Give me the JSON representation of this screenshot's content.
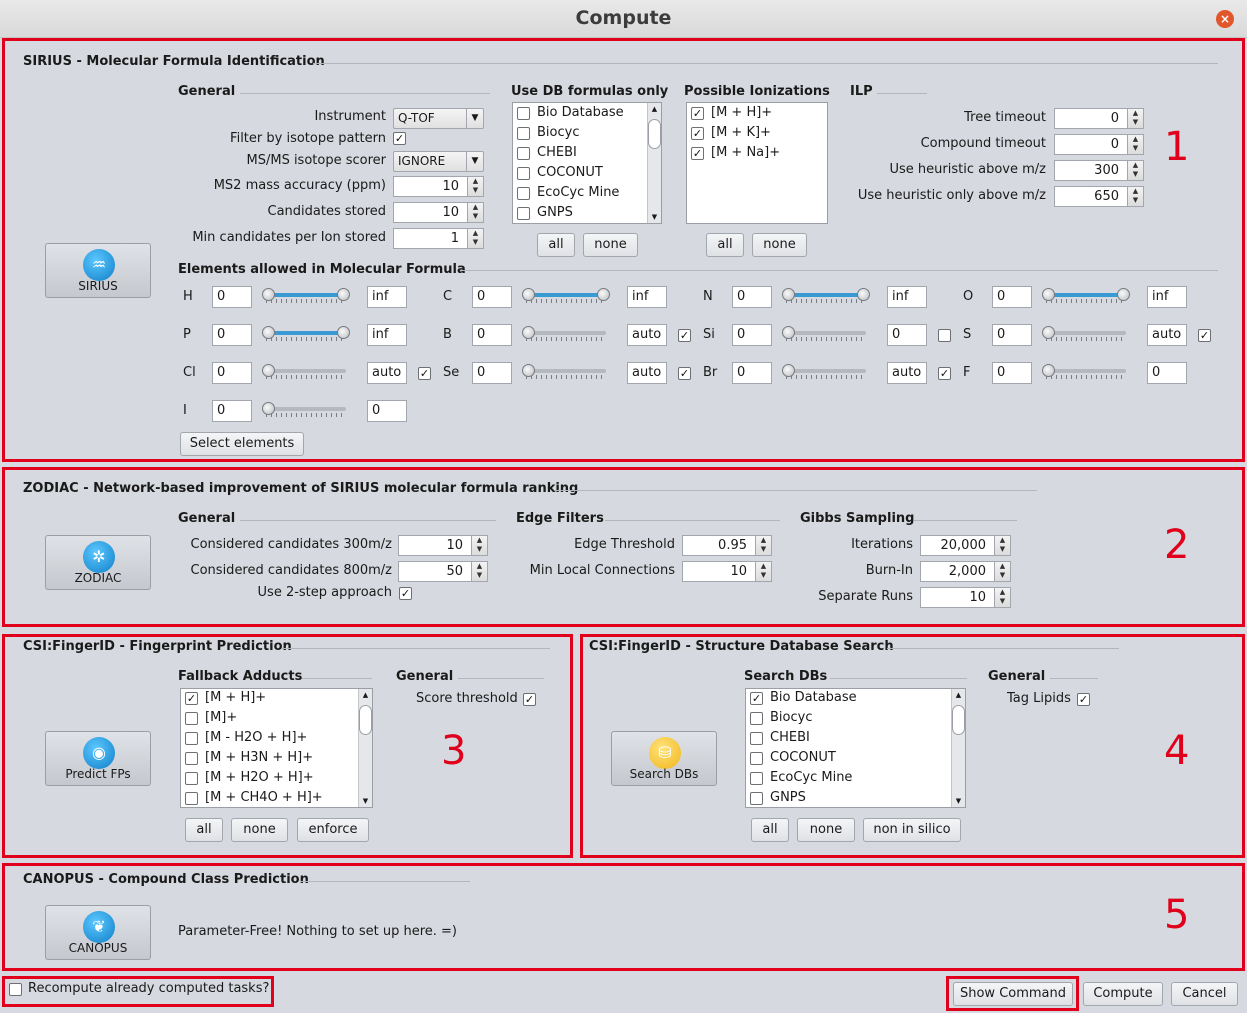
{
  "window": {
    "title": "Compute",
    "close": "×"
  },
  "sirius": {
    "title": "SIRIUS - Molecular Formula Identification",
    "marker": "1",
    "tool_label": "SIRIUS",
    "general": {
      "header": "General",
      "instrument_label": "Instrument",
      "instrument_value": "Q-TOF",
      "isotope_filter_label": "Filter by isotope pattern",
      "isotope_filter_checked": true,
      "isotope_scorer_label": "MS/MS isotope scorer",
      "isotope_scorer_value": "IGNORE",
      "ms2_accuracy_label": "MS2 mass accuracy (ppm)",
      "ms2_accuracy_value": "10",
      "candidates_label": "Candidates stored",
      "candidates_value": "10",
      "min_candidates_label": "Min candidates per Ion stored",
      "min_candidates_value": "1"
    },
    "db": {
      "header": "Use DB formulas only",
      "items": [
        "Bio Database",
        "Biocyc",
        "CHEBI",
        "COCONUT",
        "EcoCyc Mine",
        "GNPS"
      ],
      "all": "all",
      "none": "none"
    },
    "ionizations": {
      "header": "Possible Ionizations",
      "items": [
        "[M + H]+",
        "[M + K]+",
        "[M + Na]+"
      ],
      "all": "all",
      "none": "none"
    },
    "ilp": {
      "header": "ILP",
      "tree_timeout_label": "Tree timeout",
      "tree_timeout_value": "0",
      "compound_timeout_label": "Compound timeout",
      "compound_timeout_value": "0",
      "heuristic_label": "Use heuristic above m/z",
      "heuristic_value": "300",
      "heuristic_only_label": "Use heuristic only above m/z",
      "heuristic_only_value": "650"
    },
    "elements": {
      "header": "Elements allowed in Molecular Formula",
      "select_button": "Select elements",
      "list": [
        {
          "symbol": "H",
          "min": "0",
          "max": "inf",
          "fill": 1.0
        },
        {
          "symbol": "C",
          "min": "0",
          "max": "inf",
          "fill": 1.0
        },
        {
          "symbol": "N",
          "min": "0",
          "max": "inf",
          "fill": 1.0
        },
        {
          "symbol": "O",
          "min": "0",
          "max": "inf",
          "fill": 1.0
        },
        {
          "symbol": "P",
          "min": "0",
          "max": "inf",
          "fill": 1.0
        },
        {
          "symbol": "B",
          "min": "0",
          "max": "auto",
          "fill": 0.0,
          "checked": true
        },
        {
          "symbol": "Si",
          "min": "0",
          "max": "0",
          "fill": 0.0,
          "checked": false
        },
        {
          "symbol": "S",
          "min": "0",
          "max": "auto",
          "fill": 0.0,
          "checked": true
        },
        {
          "symbol": "Cl",
          "min": "0",
          "max": "auto",
          "fill": 0.0,
          "checked": true
        },
        {
          "symbol": "Se",
          "min": "0",
          "max": "auto",
          "fill": 0.0,
          "checked": true
        },
        {
          "symbol": "Br",
          "min": "0",
          "max": "auto",
          "fill": 0.0,
          "checked": true
        },
        {
          "symbol": "F",
          "min": "0",
          "max": "0",
          "fill": 0.0
        },
        {
          "symbol": "I",
          "min": "0",
          "max": "0",
          "fill": 0.0
        }
      ]
    }
  },
  "zodiac": {
    "title": "ZODIAC - Network-based improvement of SIRIUS molecular formula ranking",
    "marker": "2",
    "tool_label": "ZODIAC",
    "general": {
      "header": "General",
      "cand300_label": "Considered candidates 300m/z",
      "cand300_value": "10",
      "cand800_label": "Considered candidates 800m/z",
      "cand800_value": "50",
      "twostep_label": "Use  2-step approach",
      "twostep_checked": true
    },
    "edge": {
      "header": "Edge Filters",
      "threshold_label": "Edge Threshold",
      "threshold_value": "0.95",
      "min_local_label": "Min Local Connections",
      "min_local_value": "10"
    },
    "gibbs": {
      "header": "Gibbs Sampling",
      "iterations_label": "Iterations",
      "iterations_value": "20,000",
      "burnin_label": "Burn-In",
      "burnin_value": "2,000",
      "runs_label": "Separate Runs",
      "runs_value": "10"
    }
  },
  "fingerprint": {
    "title": "CSI:FingerID - Fingerprint Prediction",
    "marker": "3",
    "tool_label": "Predict FPs",
    "adducts": {
      "header": "Fallback Adducts",
      "items": [
        "[M + H]+",
        "[M]+",
        "[M - H2O + H]+",
        "[M + H3N + H]+",
        "[M + H2O + H]+",
        "[M + CH4O + H]+"
      ],
      "all": "all",
      "none": "none",
      "enforce": "enforce"
    },
    "general": {
      "header": "General",
      "score_label": "Score threshold",
      "score_checked": true
    }
  },
  "structure": {
    "title": "CSI:FingerID - Structure Database Search",
    "marker": "4",
    "tool_label": "Search DBs",
    "dbs": {
      "header": "Search DBs",
      "items": [
        "Bio Database",
        "Biocyc",
        "CHEBI",
        "COCONUT",
        "EcoCyc Mine",
        "GNPS"
      ],
      "all": "all",
      "none": "none",
      "non_insilico": "non in silico"
    },
    "general": {
      "header": "General",
      "tag_lipids_label": "Tag Lipids",
      "tag_lipids_checked": true
    }
  },
  "canopus": {
    "title": "CANOPUS - Compound Class Prediction",
    "marker": "5",
    "tool_label": "CANOPUS",
    "message": "Parameter-Free! Nothing to set up here. =)"
  },
  "footer": {
    "recompute_label": "Recompute already computed tasks?",
    "show_command": "Show Command",
    "compute": "Compute",
    "cancel": "Cancel"
  },
  "icons": {
    "check": "✓",
    "up": "▲",
    "down": "▼"
  }
}
